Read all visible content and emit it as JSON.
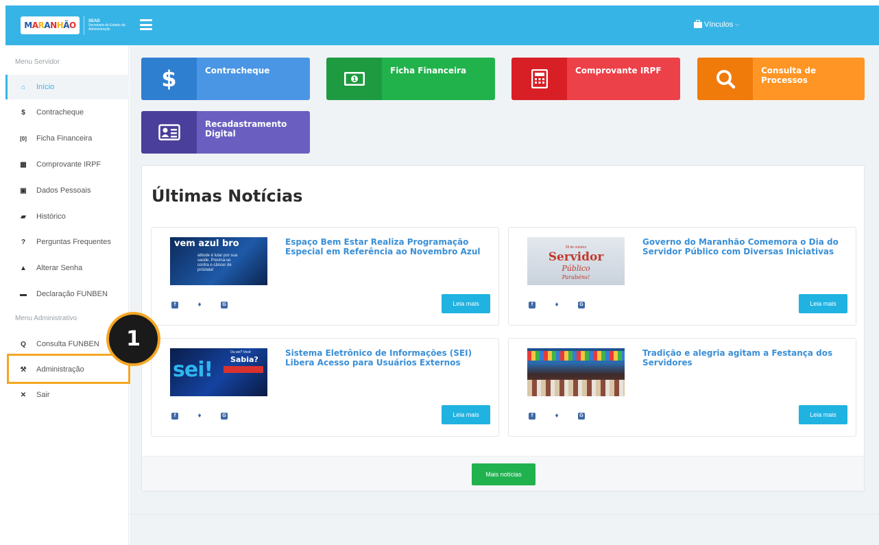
{
  "header": {
    "logo_text": "MARANHÃO",
    "sead_title": "SEAD",
    "sead_subtitle": "Secretaria de Estado da Administração",
    "vinculos_label": "Vínculos",
    "brand_color": "#37b4e6"
  },
  "sidebar": {
    "servidor_header": "Menu Servidor",
    "admin_header": "Menu Administrativo",
    "items": [
      {
        "label": "Início",
        "icon": "home-icon",
        "glyph": "⌂",
        "active": true
      },
      {
        "label": "Contracheque",
        "icon": "dollar-icon",
        "glyph": "$"
      },
      {
        "label": "Ficha Financeira",
        "icon": "money-icon",
        "glyph": "[0]"
      },
      {
        "label": "Comprovante IRPF",
        "icon": "calculator-icon",
        "glyph": "▦"
      },
      {
        "label": "Dados Pessoais",
        "icon": "id-card-icon",
        "glyph": "▣"
      },
      {
        "label": "Histórico",
        "icon": "book-icon",
        "glyph": "▰"
      },
      {
        "label": "Perguntas Frequentes",
        "icon": "question-icon",
        "glyph": "?"
      },
      {
        "label": "Alterar Senha",
        "icon": "lock-icon",
        "glyph": "▲"
      },
      {
        "label": "Declaração FUNBEN",
        "icon": "folder-icon",
        "glyph": "▬"
      }
    ],
    "admin_items": [
      {
        "label": "Consulta FUNBEN",
        "icon": "search-icon",
        "glyph": "Q"
      },
      {
        "label": "Administração",
        "icon": "wrench-icon",
        "glyph": "⚒"
      },
      {
        "label": "Sair",
        "icon": "close-icon",
        "glyph": "✕"
      }
    ]
  },
  "callout": {
    "number": "1",
    "color": "#f5a623"
  },
  "tiles": [
    {
      "label": "Contracheque",
      "icon": "dollar-icon",
      "dark": "#2f7fd1",
      "light": "#4a96e4"
    },
    {
      "label": "Ficha Financeira",
      "icon": "money-icon",
      "dark": "#1e9a40",
      "light": "#22b24c"
    },
    {
      "label": "Comprovante IRPF",
      "icon": "calculator-icon",
      "dark": "#d81f26",
      "light": "#ec4149"
    },
    {
      "label": "Consulta de Processos",
      "icon": "search-icon",
      "dark": "#f07a0a",
      "light": "#ff9524"
    },
    {
      "label": "Recadastramento Digital",
      "icon": "id-card-icon",
      "dark": "#4a3f9a",
      "light": "#6a5fc0"
    }
  ],
  "news": {
    "title": "Últimas Notícias",
    "read_more": "Leia mais",
    "more_news": "Mais notícias",
    "items": [
      {
        "title": "Espaço Bem Estar Realiza Programação Especial em Referência ao Novembro Azul",
        "thumb_text": "vem azul bro",
        "thumb_sub": "atitude é lutar por sua saúde. Previna-se contra o câncer de próstata!"
      },
      {
        "title": "Governo do Maranhão Comemora o Dia do Servidor Público com Diversas Iniciativas",
        "thumb_text": "Servidor",
        "thumb_sub": "28 de outubro",
        "thumb_script": "Público",
        "thumb_congrats": "Parabéns!"
      },
      {
        "title": "Sistema Eletrônico de Informações (SEI) Libera Acesso para Usuários Externos",
        "thumb_text": "sei!",
        "thumb_sub": "Sabia?",
        "thumb_q": "Ou sei? Você"
      },
      {
        "title": "Tradição e alegria agitam a Festança dos Servidores",
        "thumb_text": "",
        "thumb_sub": ""
      }
    ]
  }
}
